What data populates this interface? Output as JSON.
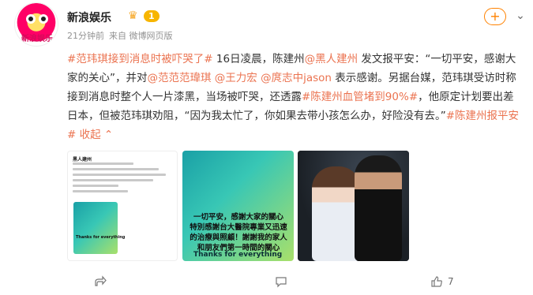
{
  "header": {
    "user_name": "新浪娱乐",
    "vip_level": "1",
    "time": "21分钟前",
    "source": "来自 微博网页版",
    "avatar_text": "新浪娱乐"
  },
  "buttons": {
    "follow": "+",
    "more": "⌄"
  },
  "post": {
    "segments": [
      {
        "type": "topic",
        "text": "#范玮琪接到消息时被吓哭了#"
      },
      {
        "type": "text",
        "text": " 16日凌晨，陈建州"
      },
      {
        "type": "at",
        "text": "@黑人建州"
      },
      {
        "type": "text",
        "text": " 发文报平安：“一切平安，感谢大家的关心”，并对"
      },
      {
        "type": "at",
        "text": "@范范范瑋琪"
      },
      {
        "type": "text",
        "text": " "
      },
      {
        "type": "at",
        "text": "@王力宏"
      },
      {
        "type": "text",
        "text": " "
      },
      {
        "type": "at",
        "text": "@庹志中jason"
      },
      {
        "type": "text",
        "text": " 表示感谢。另据台媒，范玮琪受访时称接到消息时整个人一片漆黑，当场被吓哭，还透露"
      },
      {
        "type": "topic",
        "text": "#陈建州血管堵到90%#"
      },
      {
        "type": "text",
        "text": "，他原定计划要出差日本，但被范玮琪劝阻，“因为我太忙了，你如果去带小孩怎么办，好险没有去。”"
      },
      {
        "type": "topic",
        "text": "#陈建州报平安#"
      },
      {
        "type": "text",
        "text": " "
      },
      {
        "type": "at",
        "text": "收起"
      }
    ],
    "collapse_icon": "chevron-up-icon"
  },
  "images": {
    "img1": {
      "poster": "黑人建州",
      "mini_caption": "Thanks for everything"
    },
    "img2": {
      "quote": "一切平安，感謝大家的關心 特別感謝台大醫院專業又迅速的治療與照顧！謝謝我的家人和朋友們第一時間的關心",
      "thanks": "Thanks for everything"
    }
  },
  "actions": {
    "share_count": "",
    "comment_count": "",
    "like_count": "7"
  },
  "colors": {
    "link": "#eb7350",
    "accent": "#ff8200",
    "muted": "#939393"
  }
}
